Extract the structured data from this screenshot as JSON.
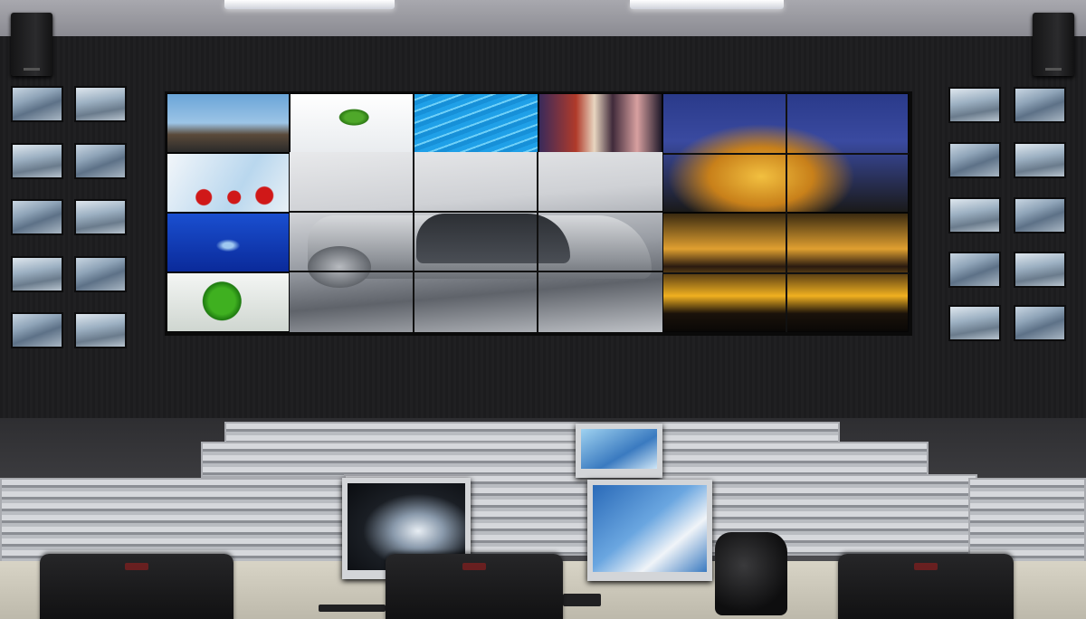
{
  "scene": {
    "title": "",
    "description_icon": "control-room-photo"
  },
  "colors": {
    "wall": "#1e1e20",
    "screen_bezel": "#0a0a0a",
    "railing": "#d6d8dc",
    "desk": "#d8d4c6"
  }
}
